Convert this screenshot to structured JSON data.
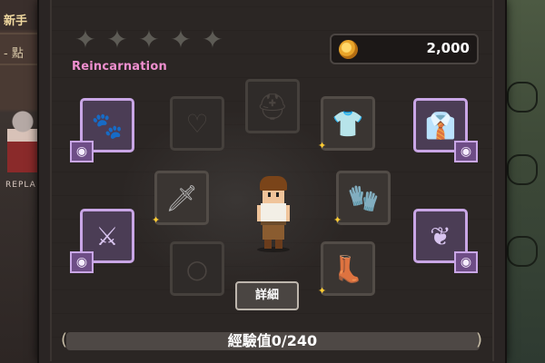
{
  "background": {
    "top_label": "新手",
    "second_label": "- 點",
    "replay_text": "REPLA"
  },
  "header": {
    "stars": [
      "empty",
      "empty",
      "empty",
      "empty",
      "empty"
    ],
    "title": "Reincarnation",
    "coins": "2,000"
  },
  "slots": [
    {
      "name": "pet-slot",
      "icon": "paw-icon",
      "glyph": "🐾",
      "style": "purple",
      "has_eye": true
    },
    {
      "name": "necklace-slot",
      "icon": "necklace-icon",
      "glyph": "♡",
      "style": "dim"
    },
    {
      "name": "helmet-slot",
      "icon": "helmet-icon",
      "glyph": "⛑",
      "style": "dim"
    },
    {
      "name": "armor-slot",
      "icon": "armor-icon",
      "glyph": "👕",
      "style": "filled",
      "has_sparkle": true
    },
    {
      "name": "cape-slot",
      "icon": "shirt-icon",
      "glyph": "👔",
      "style": "purple",
      "has_eye": true
    },
    {
      "name": "weapon-slot",
      "icon": "sword-icon",
      "glyph": "🗡",
      "style": "filled",
      "has_sparkle": true
    },
    {
      "name": "gloves-slot",
      "icon": "glove-icon",
      "glyph": "🧤",
      "style": "filled",
      "has_sparkle": true
    },
    {
      "name": "costume-weapon-slot",
      "icon": "sword-icon",
      "glyph": "⚔",
      "style": "purple",
      "has_eye": true
    },
    {
      "name": "ring-slot",
      "icon": "ring-icon",
      "glyph": "💍",
      "style": "dim"
    },
    {
      "name": "boots-slot",
      "icon": "boot-icon",
      "glyph": "👢",
      "style": "filled",
      "has_sparkle": true
    },
    {
      "name": "wings-slot",
      "icon": "wing-icon",
      "glyph": "🪽",
      "style": "purple",
      "has_eye": true
    }
  ],
  "details_button": "詳細",
  "experience": "經驗值0/240",
  "colors": {
    "title_pink": "#ef8fcf",
    "costume_purple": "#c9a6e6",
    "coin_gold": "#e9a52a"
  }
}
